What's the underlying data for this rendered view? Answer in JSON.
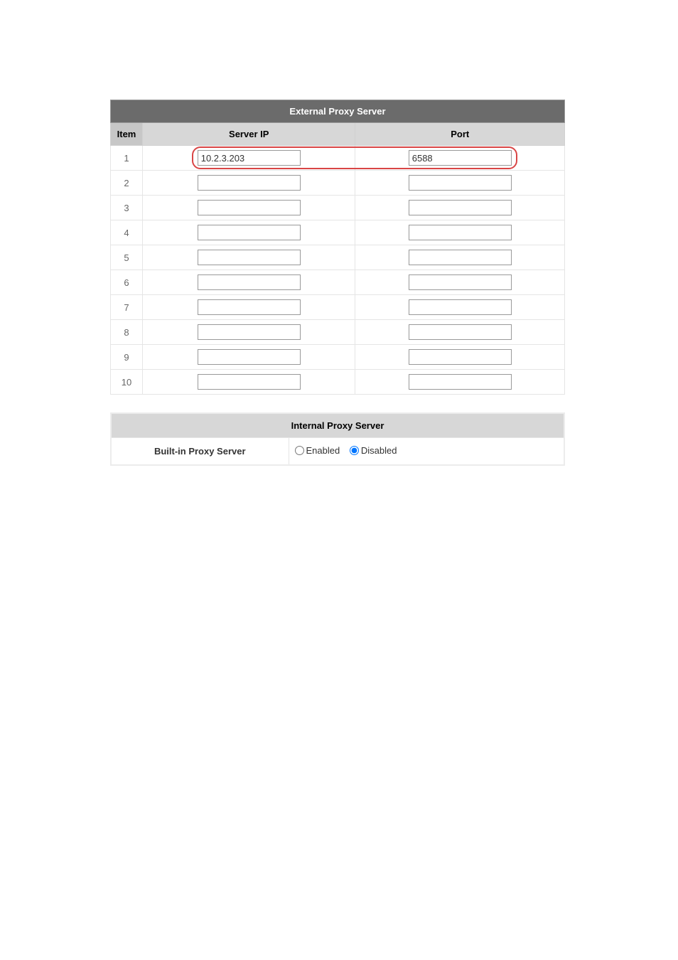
{
  "external_proxy": {
    "title": "External Proxy Server",
    "columns": {
      "item": "Item",
      "server_ip": "Server IP",
      "port": "Port"
    },
    "rows": [
      {
        "item": "1",
        "server_ip": "10.2.3.203",
        "port": "6588",
        "highlighted": true
      },
      {
        "item": "2",
        "server_ip": "",
        "port": "",
        "highlighted": false
      },
      {
        "item": "3",
        "server_ip": "",
        "port": "",
        "highlighted": false
      },
      {
        "item": "4",
        "server_ip": "",
        "port": "",
        "highlighted": false
      },
      {
        "item": "5",
        "server_ip": "",
        "port": "",
        "highlighted": false
      },
      {
        "item": "6",
        "server_ip": "",
        "port": "",
        "highlighted": false
      },
      {
        "item": "7",
        "server_ip": "",
        "port": "",
        "highlighted": false
      },
      {
        "item": "8",
        "server_ip": "",
        "port": "",
        "highlighted": false
      },
      {
        "item": "9",
        "server_ip": "",
        "port": "",
        "highlighted": false
      },
      {
        "item": "10",
        "server_ip": "",
        "port": "",
        "highlighted": false
      }
    ]
  },
  "internal_proxy": {
    "title": "Internal Proxy Server",
    "label": "Built-in Proxy Server",
    "options": {
      "enabled": "Enabled",
      "disabled": "Disabled"
    },
    "selected": "disabled"
  }
}
